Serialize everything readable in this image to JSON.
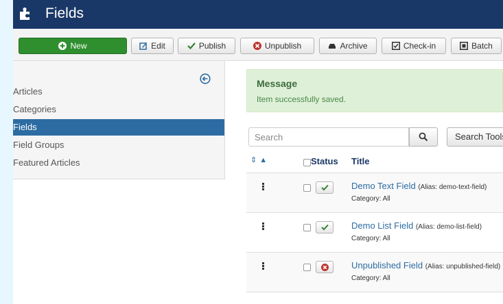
{
  "header": {
    "title": "Fields"
  },
  "toolbar": {
    "new": "New",
    "edit": "Edit",
    "publish": "Publish",
    "unpublish": "Unpublish",
    "archive": "Archive",
    "checkin": "Check-in",
    "batch": "Batch"
  },
  "sidebar": {
    "items": [
      "Articles",
      "Categories",
      "Fields",
      "Field Groups",
      "Featured Articles"
    ],
    "active": "Fields"
  },
  "message": {
    "heading": "Message",
    "text": "Item successfully saved."
  },
  "search": {
    "placeholder": "Search",
    "tools_label": "Search Tools"
  },
  "table": {
    "headers": {
      "status": "Status",
      "title": "Title"
    },
    "rows": [
      {
        "title": "Demo Text Field",
        "alias": "(Alias: demo-text-field)",
        "category": "Category: All",
        "status": "published"
      },
      {
        "title": "Demo List Field",
        "alias": "(Alias: demo-list-field)",
        "category": "Category: All",
        "status": "published"
      },
      {
        "title": "Unpublished Field",
        "alias": "(Alias: unpublished-field)",
        "category": "Category: All",
        "status": "unpublished"
      }
    ]
  },
  "colors": {
    "header_bg": "#1a3867",
    "new_button": "#2f8f2f",
    "active_item": "#2d6ca2",
    "alert_bg": "#dff0d8",
    "link": "#2d6ca2"
  }
}
